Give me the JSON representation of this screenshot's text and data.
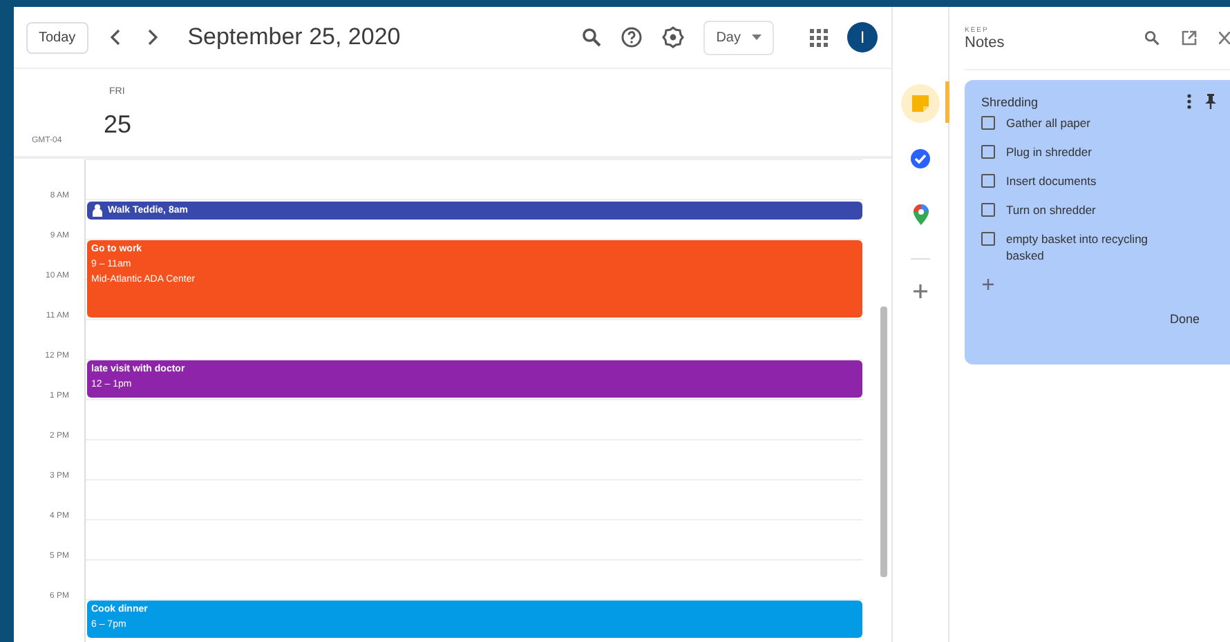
{
  "header": {
    "today_button": "Today",
    "date_title": "September 25, 2020",
    "view_select": "Day",
    "avatar_letter": "I"
  },
  "day": {
    "weekday": "FRI",
    "date": "25",
    "timezone": "GMT-04"
  },
  "hours": [
    {
      "label": "8 AM",
      "events": [
        {
          "kind": "task",
          "title": "Walk Teddie, 8am",
          "color": "#3949ab"
        }
      ]
    },
    {
      "label": "9 AM",
      "events": [
        {
          "kind": "event",
          "title": "Go to work",
          "time": "9 – 11am",
          "location": "Mid-Atlantic ADA Center",
          "color": "#f4511e"
        }
      ]
    },
    {
      "label": "10 AM"
    },
    {
      "label": "11 AM"
    },
    {
      "label": "12 PM",
      "events": [
        {
          "kind": "event",
          "title": "late visit with doctor",
          "time": "12 – 1pm",
          "color": "#8e24aa"
        }
      ]
    },
    {
      "label": "1 PM"
    },
    {
      "label": "2 PM"
    },
    {
      "label": "3 PM"
    },
    {
      "label": "4 PM"
    },
    {
      "label": "5 PM"
    },
    {
      "label": "6 PM",
      "events": [
        {
          "kind": "event",
          "title": "Cook dinner",
          "time": "6 – 7pm",
          "color": "#039be5"
        }
      ]
    }
  ],
  "side_rail": [
    {
      "kind": "keep",
      "selected": true
    },
    {
      "kind": "tasks",
      "selected": false
    },
    {
      "kind": "maps",
      "selected": false
    }
  ],
  "notes_panel": {
    "app_label": "KEEP",
    "title": "Notes",
    "note": {
      "title": "Shredding",
      "items": [
        {
          "text": "Gather all paper",
          "checked": false
        },
        {
          "text": "Plug in shredder",
          "checked": false
        },
        {
          "text": "Insert documents",
          "checked": false
        },
        {
          "text": "Turn on shredder",
          "checked": false
        },
        {
          "text": "empty basket into recycling basked",
          "checked": false
        }
      ],
      "done_button": "Done"
    }
  }
}
